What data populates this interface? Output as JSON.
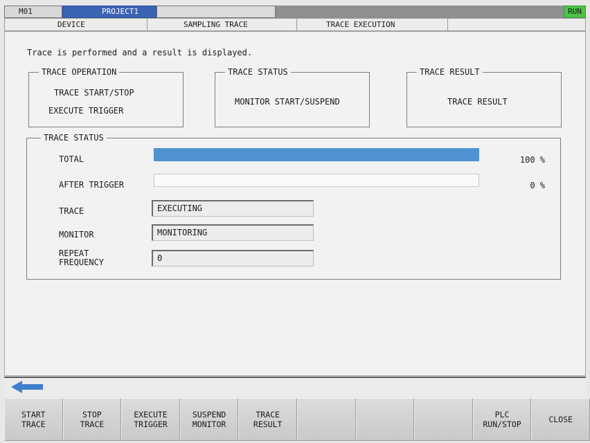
{
  "topbar": {
    "station": "M01",
    "project": "PROJECT1",
    "status": "RUN"
  },
  "breadcrumb": [
    "DEVICE",
    "SAMPLING TRACE",
    "TRACE EXECUTION"
  ],
  "description": "Trace is performed and a result is displayed.",
  "groups": {
    "operation": {
      "title": "TRACE OPERATION",
      "items": [
        "TRACE START/STOP",
        "EXECUTE TRIGGER"
      ]
    },
    "status": {
      "title": "TRACE STATUS",
      "items": [
        "MONITOR START/SUSPEND"
      ]
    },
    "result": {
      "title": "TRACE RESULT",
      "items": [
        "TRACE RESULT"
      ]
    }
  },
  "trace_status": {
    "title": "TRACE STATUS",
    "total": {
      "label": "TOTAL",
      "percent_text": "100 %",
      "fraction": 1.0
    },
    "after_trigger": {
      "label": "AFTER TRIGGER",
      "percent_text": "0 %",
      "fraction": 0.0
    },
    "trace": {
      "label": "TRACE",
      "value": "EXECUTING"
    },
    "monitor": {
      "label": "MONITOR",
      "value": "MONITORING"
    },
    "repeat": {
      "label_line1": "REPEAT",
      "label_line2": "FREQUENCY",
      "value": "0"
    }
  },
  "function_keys": [
    "START\nTRACE",
    "STOP\nTRACE",
    "EXECUTE\nTRIGGER",
    "SUSPEND\nMONITOR",
    "TRACE\nRESULT",
    "",
    "",
    "",
    "PLC\nRUN/STOP",
    "CLOSE"
  ],
  "colors": {
    "project_bg": "#3c64b4",
    "run_bg": "#4dc248",
    "progress_fill": "#4f92d0",
    "arrow": "#3f7fcf"
  },
  "icons": {
    "back": "left-arrow-icon"
  }
}
